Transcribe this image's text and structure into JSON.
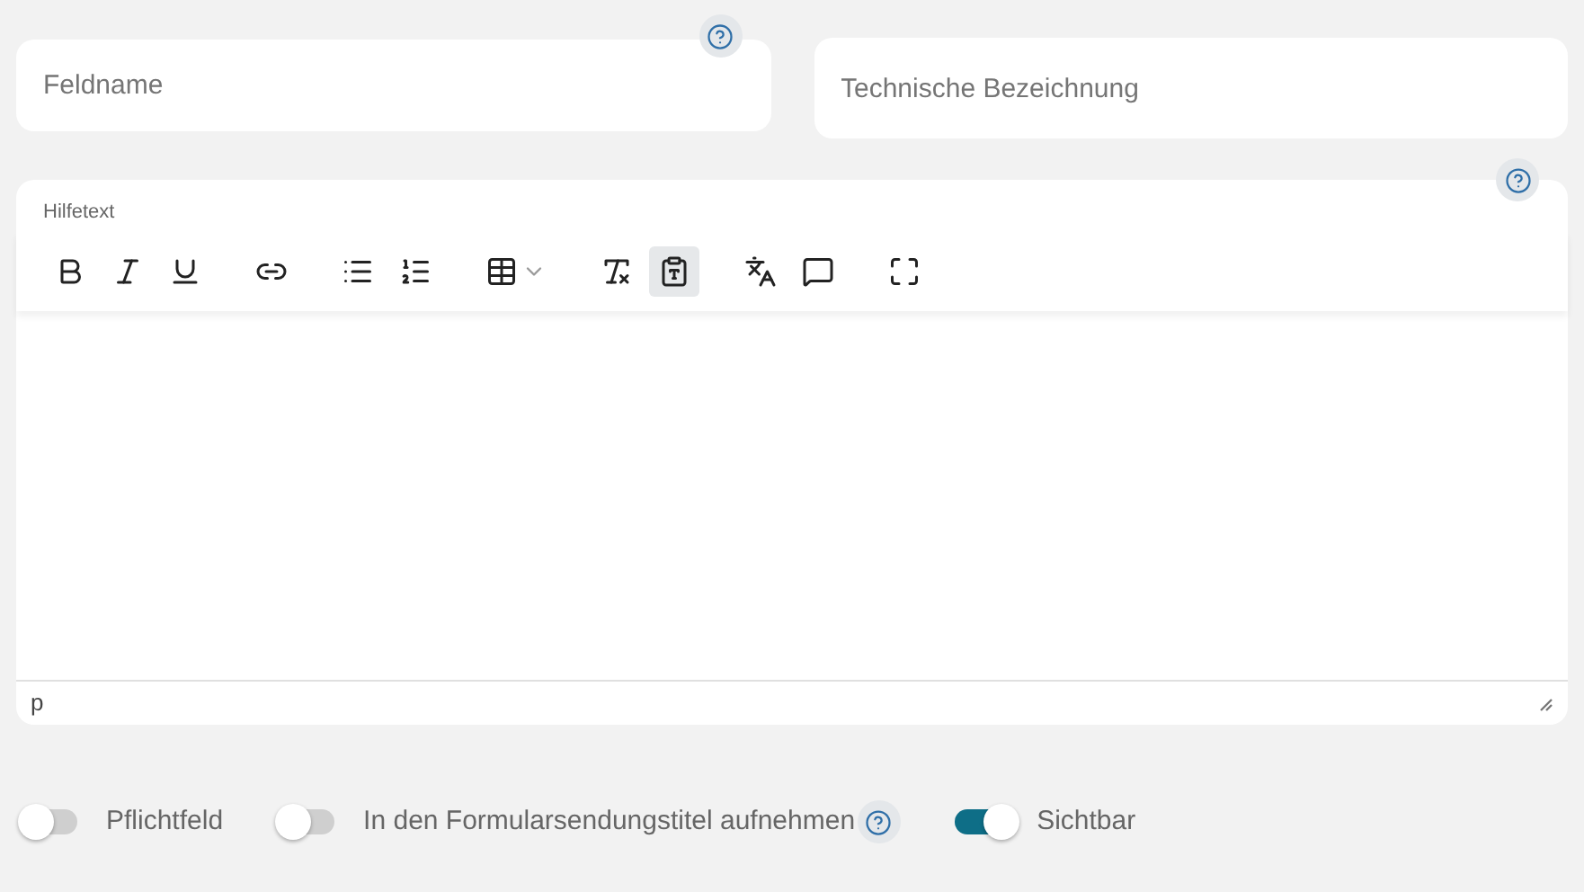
{
  "fields": [
    {
      "placeholder": "Feldname",
      "help": true
    },
    {
      "placeholder": "Technische Bezeichnung"
    }
  ],
  "editor": {
    "label": "Hilfetext",
    "help": true,
    "toolbar": [
      [
        {
          "kind": "bold",
          "selected": false
        },
        {
          "kind": "italic",
          "selected": false
        },
        {
          "kind": "underline",
          "selected": false
        }
      ],
      [
        {
          "kind": "link",
          "selected": false
        }
      ],
      [
        {
          "kind": "bullets",
          "selected": false
        },
        {
          "kind": "numbers",
          "selected": false
        }
      ],
      [
        {
          "kind": "table",
          "selected": false
        }
      ],
      [
        {
          "kind": "clear",
          "selected": false
        },
        {
          "kind": "paste",
          "selected": true
        }
      ],
      [
        {
          "kind": "translate",
          "selected": false
        },
        {
          "kind": "comment",
          "selected": false
        }
      ],
      [
        {
          "kind": "fullscreen",
          "selected": false
        }
      ]
    ],
    "path": "p"
  },
  "toggles": [
    {
      "label": "Pflichtfeld",
      "on": false
    },
    {
      "label": "In den Formularsendungstitel aufnehmen",
      "on": false,
      "help": true
    },
    {
      "label": "Sichtbar",
      "on": true
    }
  ]
}
